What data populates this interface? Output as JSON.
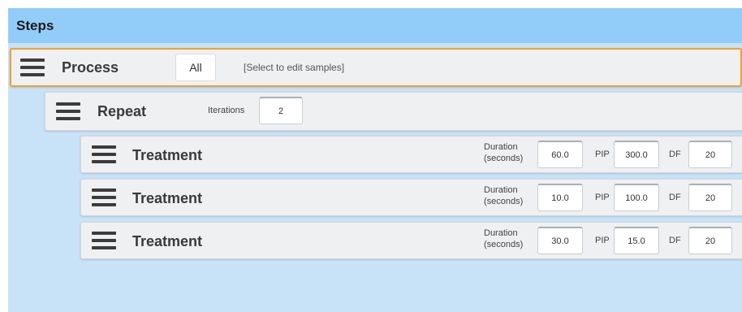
{
  "header": {
    "title": "Steps"
  },
  "process": {
    "title": "Process",
    "all_button": "All",
    "select_hint": "[Select to edit samples]"
  },
  "repeat": {
    "title": "Repeat",
    "iterations_label": "Iterations",
    "iterations_value": "2"
  },
  "labels": {
    "duration_line1": "Duration",
    "duration_line2": "(seconds)",
    "pip": "PIP",
    "df": "DF"
  },
  "treatments": [
    {
      "title": "Treatment",
      "duration": "60.0",
      "pip": "300.0",
      "df": "20"
    },
    {
      "title": "Treatment",
      "duration": "10.0",
      "pip": "100.0",
      "df": "20"
    },
    {
      "title": "Treatment",
      "duration": "30.0",
      "pip": "15.0",
      "df": "20"
    }
  ],
  "colors": {
    "header_bg": "#92ccf8",
    "canvas_bg": "#c8e2f7",
    "selected_border": "#f0a12f"
  }
}
